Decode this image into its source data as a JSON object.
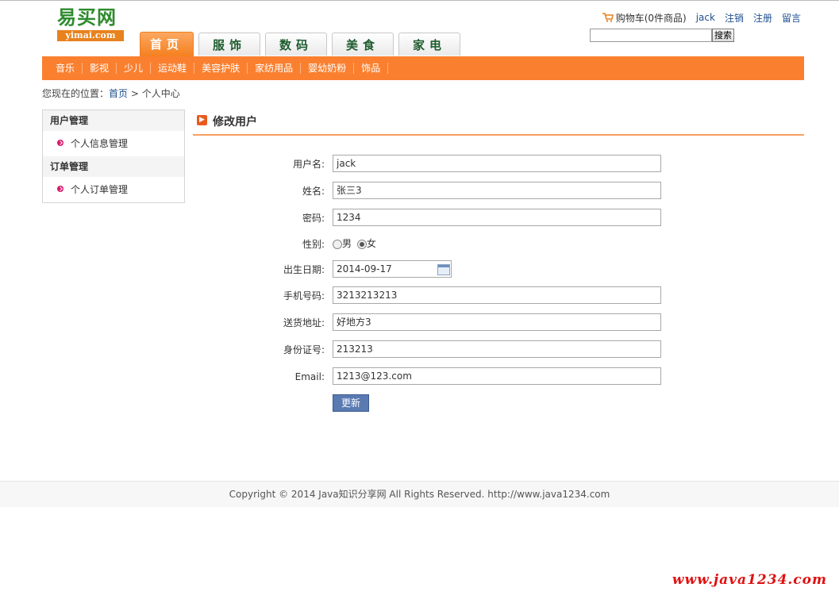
{
  "logo": {
    "cn": "易买网",
    "en": "yimai.com"
  },
  "toplinks": {
    "cart": "购物车(0件商品)",
    "user": "jack",
    "logout": "注销",
    "register": "注册",
    "message": "留言"
  },
  "search": {
    "value": "",
    "button": "搜索"
  },
  "tabs": [
    {
      "label": "首页",
      "active": true
    },
    {
      "label": "服饰"
    },
    {
      "label": "数码"
    },
    {
      "label": "美食"
    },
    {
      "label": "家电"
    }
  ],
  "categories": [
    "音乐",
    "影视",
    "少儿",
    "运动鞋",
    "美容护肤",
    "家纺用品",
    "婴幼奶粉",
    "饰品"
  ],
  "breadcrumb": {
    "prefix": "您现在的位置：",
    "home": "首页",
    "sep": " > ",
    "current": "个人中心"
  },
  "sidebar": {
    "groups": [
      {
        "title": "用户管理",
        "item": "个人信息管理"
      },
      {
        "title": "订单管理",
        "item": "个人订单管理"
      }
    ]
  },
  "main": {
    "title": "修改用户"
  },
  "form": {
    "username": {
      "label": "用户名:",
      "value": "jack"
    },
    "name": {
      "label": "姓名:",
      "value": "张三3"
    },
    "password": {
      "label": "密码:",
      "value": "1234"
    },
    "gender": {
      "label": "性别:",
      "male": "男",
      "female": "女",
      "selected": "女"
    },
    "birthday": {
      "label": "出生日期:",
      "value": "2014-09-17"
    },
    "mobile": {
      "label": "手机号码:",
      "value": "3213213213"
    },
    "address": {
      "label": "送货地址:",
      "value": "好地方3"
    },
    "idcard": {
      "label": "身份证号:",
      "value": "213213"
    },
    "email": {
      "label": "Email:",
      "value": "1213@123.com"
    },
    "submit": "更新"
  },
  "footer": {
    "text": "Copyright © 2014 Java知识分享网 All Rights Reserved. http://www.java1234.com"
  },
  "watermark": "www.java1234.com",
  "colors": {
    "accent": "#fa8030",
    "link": "#1e4f8f",
    "logo_green": "#2e8b2e",
    "button": "#5a7ab2"
  }
}
